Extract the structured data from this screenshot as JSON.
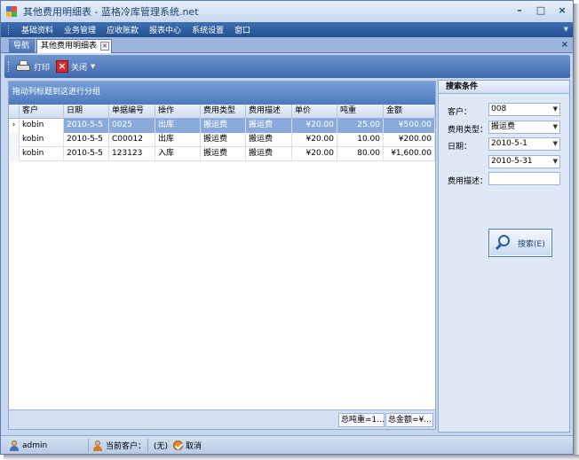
{
  "window": {
    "title": "其他费用明细表 - 蓝格冷库管理系统.net",
    "minimize_label": "–",
    "maximize_label": "□",
    "close_label": "×"
  },
  "menu": [
    "基础资料",
    "业务管理",
    "应收账款",
    "报表中心",
    "系统设置",
    "窗口"
  ],
  "tabs": [
    {
      "label": "导航"
    },
    {
      "label": "其他费用明细表"
    }
  ],
  "tab_close_label": "×",
  "pane_close_label": "×",
  "toolbar": {
    "print_label": "打印",
    "close_label": "关闭"
  },
  "grid": {
    "group_hint": "拖动列标题到这进行分组",
    "columns": [
      "客户",
      "日期",
      "单据编号",
      "操作",
      "费用类型",
      "费用描述",
      "单价",
      "吨重",
      "金额"
    ],
    "rows": [
      [
        "kobin",
        "2010-5-5",
        "0025",
        "出库",
        "搬运费",
        "搬运费",
        "¥20.00",
        "25.00",
        "¥500.00"
      ],
      [
        "kobin",
        "2010-5-5",
        "C00012",
        "出库",
        "搬运费",
        "搬运费",
        "¥20.00",
        "10.00",
        "¥200.00"
      ],
      [
        "kobin",
        "2010-5-5",
        "123123",
        "入库",
        "搬运费",
        "搬运费",
        "¥20.00",
        "80.00",
        "¥1,600.00"
      ]
    ],
    "selected_row_indicator": "›",
    "footer": {
      "total_weight": "总吨重=1...",
      "total_amount": "总金额=¥..."
    }
  },
  "search": {
    "title": "搜索条件",
    "customer_label": "客户：",
    "customer_value": "008",
    "fee_type_label": "费用类型：",
    "fee_type_value": "搬运费",
    "date_label": "日期：",
    "date_from": "2010-5-1",
    "date_to": "2010-5-31",
    "fee_desc_label": "费用描述：",
    "fee_desc_value": "",
    "search_button": "搜索(E)"
  },
  "status": {
    "user": "admin",
    "current_customer_label": "当前客户：",
    "current_customer_value": "(无)",
    "cancel_label": "取消"
  },
  "colors": {
    "menu_bg": "#23508f",
    "toolbar_bg": "#3e69ad",
    "selection": "#8aaadb",
    "window_bg": "#c6d6ec"
  }
}
